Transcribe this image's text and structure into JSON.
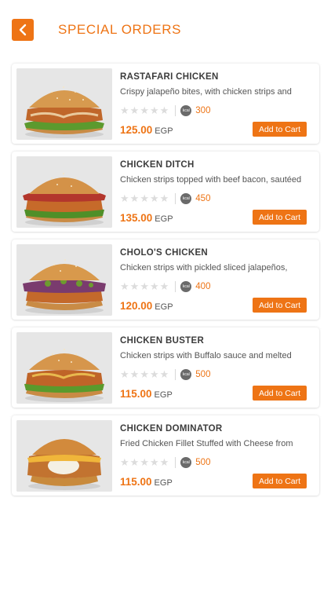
{
  "header": {
    "title": "SPECIAL ORDERS",
    "back_icon": "chevron-left-icon"
  },
  "theme": {
    "accent": "#ee7415",
    "text": "#3c3c3c",
    "star_empty": "#dcdcdc"
  },
  "products": [
    {
      "name": "RASTAFARI CHICKEN",
      "description": "Crispy jalapeño bites, with chicken strips and",
      "rating": 0,
      "rating_max": 5,
      "kcal_icon": "kcal",
      "calories": "300",
      "price": "125.00",
      "currency": "EGP",
      "cart_label": "Add to Cart"
    },
    {
      "name": "CHICKEN DITCH",
      "description": "Chicken strips topped with beef bacon, sautéed",
      "rating": 0,
      "rating_max": 5,
      "kcal_icon": "kcal",
      "calories": "450",
      "price": "135.00",
      "currency": "EGP",
      "cart_label": "Add to Cart"
    },
    {
      "name": "CHOLO'S CHICKEN",
      "description": "Chicken strips with pickled sliced jalapeños,",
      "rating": 0,
      "rating_max": 5,
      "kcal_icon": "kcal",
      "calories": "400",
      "price": "120.00",
      "currency": "EGP",
      "cart_label": "Add to Cart"
    },
    {
      "name": "CHICKEN BUSTER",
      "description": "Chicken strips with Buffalo sauce and melted",
      "rating": 0,
      "rating_max": 5,
      "kcal_icon": "kcal",
      "calories": "500",
      "price": "115.00",
      "currency": "EGP",
      "cart_label": "Add to Cart"
    },
    {
      "name": "CHICKEN DOMINATOR",
      "description": "Fried Chicken Fillet Stuffed with Cheese from",
      "rating": 0,
      "rating_max": 5,
      "kcal_icon": "kcal",
      "calories": "500",
      "price": "115.00",
      "currency": "EGP",
      "cart_label": "Add to Cart"
    }
  ]
}
